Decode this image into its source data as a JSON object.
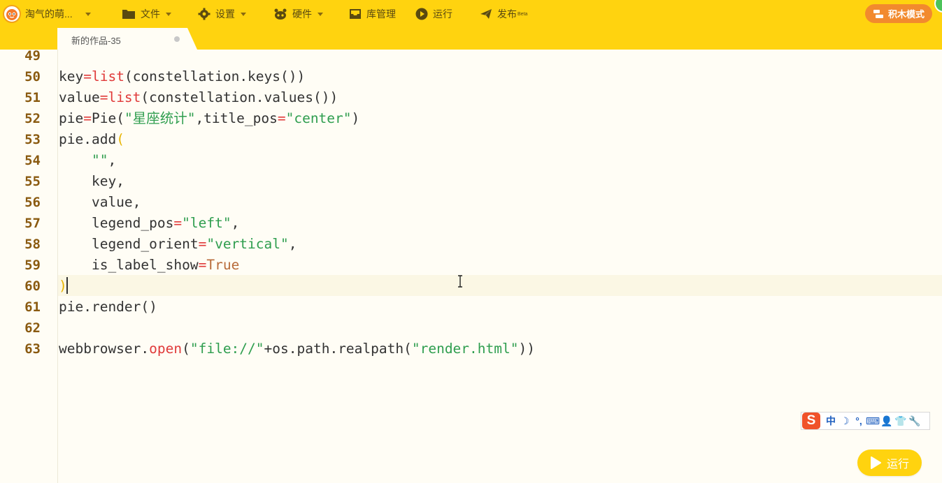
{
  "toolbar": {
    "user_name": "淘气的萌...",
    "file_label": "文件",
    "settings_label": "设置",
    "hardware_label": "硬件",
    "library_label": "库管理",
    "run_label": "运行",
    "publish_label": "发布",
    "publish_badge": "Beta",
    "mode_label": "积木模式"
  },
  "tab": {
    "title": "新的作品-35"
  },
  "editor": {
    "lines": [
      {
        "num": "49",
        "text": ""
      },
      {
        "num": "50",
        "text": "key=list(constellation.keys())"
      },
      {
        "num": "51",
        "text": "value=list(constellation.values())"
      },
      {
        "num": "52",
        "text": "pie=Pie(\"星座统计\",title_pos=\"center\")"
      },
      {
        "num": "53",
        "text": "pie.add("
      },
      {
        "num": "54",
        "text": "    \"\","
      },
      {
        "num": "55",
        "text": "    key,"
      },
      {
        "num": "56",
        "text": "    value,"
      },
      {
        "num": "57",
        "text": "    legend_pos=\"left\","
      },
      {
        "num": "58",
        "text": "    legend_orient=\"vertical\","
      },
      {
        "num": "59",
        "text": "    is_label_show=True"
      },
      {
        "num": "60",
        "text": ")"
      },
      {
        "num": "61",
        "text": "pie.render()"
      },
      {
        "num": "62",
        "text": ""
      },
      {
        "num": "63",
        "text": "webbrowser.open(\"file://\"+os.path.realpath(\"render.html\"))"
      }
    ]
  },
  "ime": {
    "logo": "S",
    "chinese_mode": "中",
    "moon": "☽",
    "punct": "°,",
    "keyboard": "⌨",
    "user": "👤",
    "skin": "👕",
    "tools": "🔧"
  },
  "run_button": {
    "label": "运行"
  },
  "colors": {
    "toolbar_bg": "#ffd30f",
    "mode_button_bg": "#f28a2e",
    "keyword": "#e03a3a",
    "string": "#2f9e4f",
    "constant": "#b86b3a",
    "line_number": "#8a5a10"
  }
}
